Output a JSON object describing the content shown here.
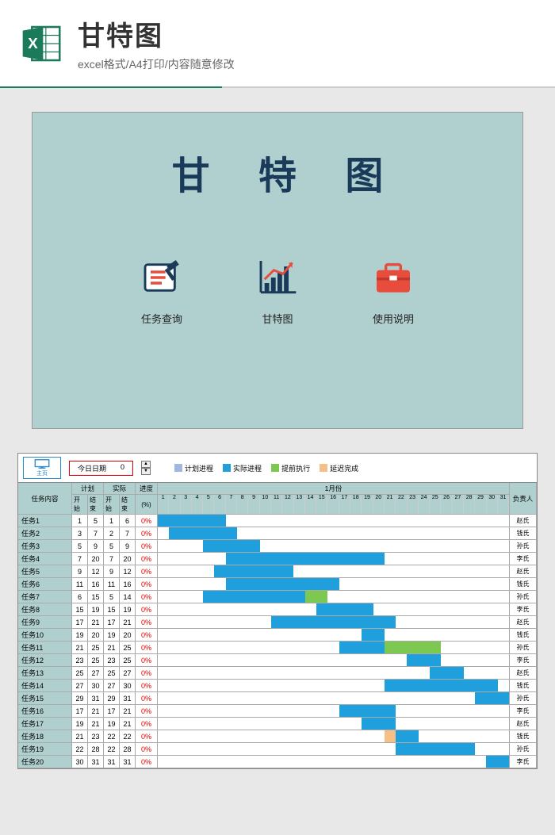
{
  "header": {
    "title": "甘特图",
    "subtitle": "excel格式/A4打印/内容随意修改"
  },
  "cover": {
    "title": "甘 特 图",
    "nav": [
      {
        "label": "任务查询",
        "icon": "note-icon"
      },
      {
        "label": "甘特图",
        "icon": "chart-icon"
      },
      {
        "label": "使用说明",
        "icon": "briefcase-icon"
      }
    ]
  },
  "gantt": {
    "home_label": "主页",
    "today_label": "今日日期",
    "today_value": "0",
    "legend": [
      {
        "label": "计划进程",
        "color": "#a0b8e0"
      },
      {
        "label": "实际进程",
        "color": "#1fa0dc"
      },
      {
        "label": "提前执行",
        "color": "#7dc850"
      },
      {
        "label": "延迟完成",
        "color": "#f5c088"
      }
    ],
    "columns": {
      "task": "任务内容",
      "plan": "计划",
      "actual": "实际",
      "progress": "进度",
      "start": "开始",
      "end": "结束",
      "pct": "(%)",
      "month": "1月份",
      "assignee": "负责人"
    },
    "days": 31,
    "rows": [
      {
        "task": "任务1",
        "ps": 1,
        "pe": 5,
        "as": 1,
        "ae": 6,
        "pct": "0%",
        "assignee": "赵氏",
        "bars": [
          {
            "s": 1,
            "e": 6,
            "c": "#1fa0dc"
          }
        ]
      },
      {
        "task": "任务2",
        "ps": 3,
        "pe": 7,
        "as": 2,
        "ae": 7,
        "pct": "0%",
        "assignee": "钱氏",
        "bars": [
          {
            "s": 2,
            "e": 7,
            "c": "#1fa0dc"
          }
        ]
      },
      {
        "task": "任务3",
        "ps": 5,
        "pe": 9,
        "as": 5,
        "ae": 9,
        "pct": "0%",
        "assignee": "孙氏",
        "bars": [
          {
            "s": 5,
            "e": 9,
            "c": "#1fa0dc"
          }
        ]
      },
      {
        "task": "任务4",
        "ps": 7,
        "pe": 20,
        "as": 7,
        "ae": 20,
        "pct": "0%",
        "assignee": "李氏",
        "bars": [
          {
            "s": 7,
            "e": 20,
            "c": "#1fa0dc"
          }
        ]
      },
      {
        "task": "任务5",
        "ps": 9,
        "pe": 12,
        "as": 9,
        "ae": 12,
        "pct": "0%",
        "assignee": "赵氏",
        "bars": [
          {
            "s": 6,
            "e": 12,
            "c": "#1fa0dc"
          }
        ]
      },
      {
        "task": "任务6",
        "ps": 11,
        "pe": 16,
        "as": 11,
        "ae": 16,
        "pct": "0%",
        "assignee": "钱氏",
        "bars": [
          {
            "s": 7,
            "e": 16,
            "c": "#1fa0dc"
          }
        ]
      },
      {
        "task": "任务7",
        "ps": 6,
        "pe": 15,
        "as": 5,
        "ae": 14,
        "pct": "0%",
        "assignee": "孙氏",
        "bars": [
          {
            "s": 5,
            "e": 14,
            "c": "#1fa0dc"
          },
          {
            "s": 14,
            "e": 15,
            "c": "#7dc850"
          }
        ]
      },
      {
        "task": "任务8",
        "ps": 15,
        "pe": 19,
        "as": 15,
        "ae": 19,
        "pct": "0%",
        "assignee": "李氏",
        "bars": [
          {
            "s": 15,
            "e": 19,
            "c": "#1fa0dc"
          }
        ]
      },
      {
        "task": "任务9",
        "ps": 17,
        "pe": 21,
        "as": 17,
        "ae": 21,
        "pct": "0%",
        "assignee": "赵氏",
        "bars": [
          {
            "s": 11,
            "e": 21,
            "c": "#1fa0dc"
          }
        ]
      },
      {
        "task": "任务10",
        "ps": 19,
        "pe": 20,
        "as": 19,
        "ae": 20,
        "pct": "0%",
        "assignee": "钱氏",
        "bars": [
          {
            "s": 19,
            "e": 20,
            "c": "#1fa0dc"
          }
        ]
      },
      {
        "task": "任务11",
        "ps": 21,
        "pe": 25,
        "as": 21,
        "ae": 25,
        "pct": "0%",
        "assignee": "孙氏",
        "bars": [
          {
            "s": 17,
            "e": 21,
            "c": "#1fa0dc"
          },
          {
            "s": 21,
            "e": 25,
            "c": "#7dc850"
          }
        ]
      },
      {
        "task": "任务12",
        "ps": 23,
        "pe": 25,
        "as": 23,
        "ae": 25,
        "pct": "0%",
        "assignee": "李氏",
        "bars": [
          {
            "s": 23,
            "e": 25,
            "c": "#1fa0dc"
          }
        ]
      },
      {
        "task": "任务13",
        "ps": 25,
        "pe": 27,
        "as": 25,
        "ae": 27,
        "pct": "0%",
        "assignee": "赵氏",
        "bars": [
          {
            "s": 25,
            "e": 27,
            "c": "#1fa0dc"
          }
        ]
      },
      {
        "task": "任务14",
        "ps": 27,
        "pe": 30,
        "as": 27,
        "ae": 30,
        "pct": "0%",
        "assignee": "钱氏",
        "bars": [
          {
            "s": 21,
            "e": 30,
            "c": "#1fa0dc"
          }
        ]
      },
      {
        "task": "任务15",
        "ps": 29,
        "pe": 31,
        "as": 29,
        "ae": 31,
        "pct": "0%",
        "assignee": "孙氏",
        "bars": [
          {
            "s": 29,
            "e": 31,
            "c": "#1fa0dc"
          }
        ]
      },
      {
        "task": "任务16",
        "ps": 17,
        "pe": 21,
        "as": 17,
        "ae": 21,
        "pct": "0%",
        "assignee": "李氏",
        "bars": [
          {
            "s": 17,
            "e": 21,
            "c": "#1fa0dc"
          }
        ]
      },
      {
        "task": "任务17",
        "ps": 19,
        "pe": 21,
        "as": 19,
        "ae": 21,
        "pct": "0%",
        "assignee": "赵氏",
        "bars": [
          {
            "s": 19,
            "e": 21,
            "c": "#1fa0dc"
          }
        ]
      },
      {
        "task": "任务18",
        "ps": 21,
        "pe": 23,
        "as": 22,
        "ae": 22,
        "pct": "0%",
        "assignee": "钱氏",
        "bars": [
          {
            "s": 21,
            "e": 22,
            "c": "#f5c088"
          },
          {
            "s": 22,
            "e": 23,
            "c": "#1fa0dc"
          }
        ]
      },
      {
        "task": "任务19",
        "ps": 22,
        "pe": 28,
        "as": 22,
        "ae": 28,
        "pct": "0%",
        "assignee": "孙氏",
        "bars": [
          {
            "s": 22,
            "e": 28,
            "c": "#1fa0dc"
          }
        ]
      },
      {
        "task": "任务20",
        "ps": 30,
        "pe": 31,
        "as": 31,
        "ae": 31,
        "pct": "0%",
        "assignee": "李氏",
        "bars": [
          {
            "s": 30,
            "e": 31,
            "c": "#1fa0dc"
          }
        ]
      }
    ]
  },
  "chart_data": {
    "type": "gantt",
    "title": "甘特图",
    "x_range": [
      1,
      31
    ],
    "xlabel": "1月份",
    "series_legend": [
      "计划进程",
      "实际进程",
      "提前执行",
      "延迟完成"
    ],
    "tasks": [
      {
        "name": "任务1",
        "plan": [
          1,
          5
        ],
        "actual": [
          1,
          6
        ],
        "assignee": "赵氏"
      },
      {
        "name": "任务2",
        "plan": [
          3,
          7
        ],
        "actual": [
          2,
          7
        ],
        "assignee": "钱氏"
      },
      {
        "name": "任务3",
        "plan": [
          5,
          9
        ],
        "actual": [
          5,
          9
        ],
        "assignee": "孙氏"
      },
      {
        "name": "任务4",
        "plan": [
          7,
          20
        ],
        "actual": [
          7,
          20
        ],
        "assignee": "李氏"
      },
      {
        "name": "任务5",
        "plan": [
          9,
          12
        ],
        "actual": [
          9,
          12
        ],
        "assignee": "赵氏"
      },
      {
        "name": "任务6",
        "plan": [
          11,
          16
        ],
        "actual": [
          11,
          16
        ],
        "assignee": "钱氏"
      },
      {
        "name": "任务7",
        "plan": [
          6,
          15
        ],
        "actual": [
          5,
          14
        ],
        "assignee": "孙氏"
      },
      {
        "name": "任务8",
        "plan": [
          15,
          19
        ],
        "actual": [
          15,
          19
        ],
        "assignee": "李氏"
      },
      {
        "name": "任务9",
        "plan": [
          17,
          21
        ],
        "actual": [
          17,
          21
        ],
        "assignee": "赵氏"
      },
      {
        "name": "任务10",
        "plan": [
          19,
          20
        ],
        "actual": [
          19,
          20
        ],
        "assignee": "钱氏"
      },
      {
        "name": "任务11",
        "plan": [
          21,
          25
        ],
        "actual": [
          21,
          25
        ],
        "assignee": "孙氏"
      },
      {
        "name": "任务12",
        "plan": [
          23,
          25
        ],
        "actual": [
          23,
          25
        ],
        "assignee": "李氏"
      },
      {
        "name": "任务13",
        "plan": [
          25,
          27
        ],
        "actual": [
          25,
          27
        ],
        "assignee": "赵氏"
      },
      {
        "name": "任务14",
        "plan": [
          27,
          30
        ],
        "actual": [
          27,
          30
        ],
        "assignee": "钱氏"
      },
      {
        "name": "任务15",
        "plan": [
          29,
          31
        ],
        "actual": [
          29,
          31
        ],
        "assignee": "孙氏"
      },
      {
        "name": "任务16",
        "plan": [
          17,
          21
        ],
        "actual": [
          17,
          21
        ],
        "assignee": "李氏"
      },
      {
        "name": "任务17",
        "plan": [
          19,
          21
        ],
        "actual": [
          19,
          21
        ],
        "assignee": "赵氏"
      },
      {
        "name": "任务18",
        "plan": [
          21,
          23
        ],
        "actual": [
          22,
          22
        ],
        "assignee": "钱氏"
      },
      {
        "name": "任务19",
        "plan": [
          22,
          28
        ],
        "actual": [
          22,
          28
        ],
        "assignee": "孙氏"
      },
      {
        "name": "任务20",
        "plan": [
          30,
          31
        ],
        "actual": [
          31,
          31
        ],
        "assignee": "李氏"
      }
    ]
  }
}
